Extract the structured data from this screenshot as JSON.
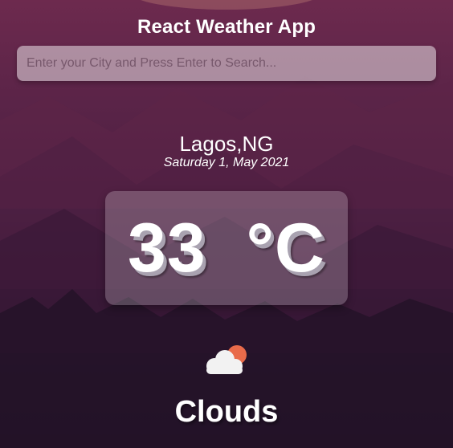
{
  "app": {
    "title": "React Weather App"
  },
  "search": {
    "placeholder": "Enter your City and Press Enter to Search...",
    "value": ""
  },
  "location": {
    "name": "Lagos,NG",
    "date": "Saturday 1, May 2021"
  },
  "weather": {
    "temperature_text": "33  °C",
    "condition": "Clouds",
    "icon": "cloud-sun-icon"
  },
  "colors": {
    "background_top": "#6d2a4e",
    "background_bottom": "#1b1326",
    "sun": "#e96b4a",
    "cloud": "#f2f2f2"
  }
}
